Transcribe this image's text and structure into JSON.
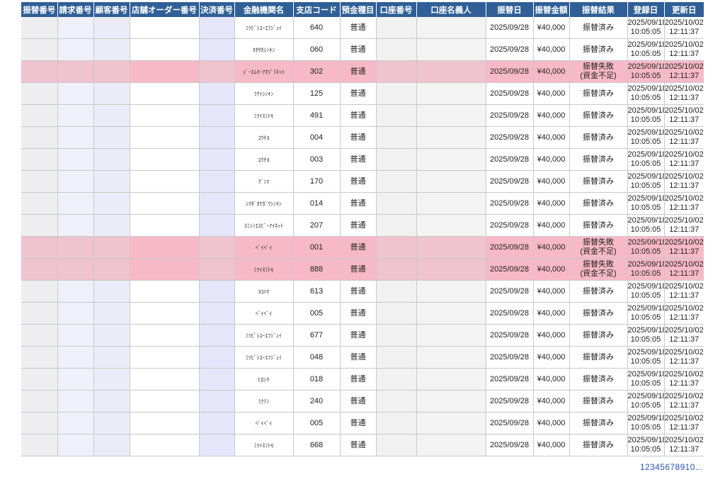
{
  "columns": [
    "振替番号",
    "請求番号",
    "顧客番号",
    "店舗オーダー番号",
    "決済番号",
    "金融機関名",
    "支店コード",
    "預金種目",
    "口座番号",
    "口座名義人",
    "振替日",
    "振替金額",
    "振替結果",
    "登録日",
    "更新日"
  ],
  "rows": [
    {
      "bank": "ﾐﾂﾋﾞｼﾕｰｴﾌｼﾞｪｲ",
      "branch": "640",
      "type": "普通",
      "date": "2025/09/28",
      "amount": "¥40,000",
      "result": "振替済み",
      "result2": "",
      "reg1": "2025/09/18",
      "reg2": "10:05:05",
      "upd1": "2025/10/02",
      "upd2": "12:11:37",
      "failed": false
    },
    {
      "bank": "ｵｵｻｶｼﾝｷﾝ",
      "branch": "060",
      "type": "普通",
      "date": "2025/09/28",
      "amount": "¥40,000",
      "result": "振替済み",
      "result2": "",
      "reg1": "2025/09/18",
      "reg2": "10:05:05",
      "upd1": "2025/10/02",
      "upd2": "12:11:37",
      "failed": false
    },
    {
      "bank": "ｼﾞｰｴﾑｵｰｱｵｿﾞﾗﾈｯﾄ",
      "branch": "302",
      "type": "普通",
      "date": "2025/09/28",
      "amount": "¥40,000",
      "result": "振替失敗",
      "result2": "(資金不足)",
      "reg1": "2025/09/18",
      "reg2": "10:05:05",
      "upd1": "2025/10/02",
      "upd2": "12:11:37",
      "failed": true
    },
    {
      "bank": "ﾌｸｲｼﾝｷﾝ",
      "branch": "125",
      "type": "普通",
      "date": "2025/09/28",
      "amount": "¥40,000",
      "result": "振替済み",
      "result2": "",
      "reg1": "2025/09/18",
      "reg2": "10:05:05",
      "upd1": "2025/10/02",
      "upd2": "12:11:37",
      "failed": false
    },
    {
      "bank": "ﾐﾂｲｽﾐﾄﾓ",
      "branch": "491",
      "type": "普通",
      "date": "2025/09/28",
      "amount": "¥40,000",
      "result": "振替済み",
      "result2": "",
      "reg1": "2025/09/18",
      "reg2": "10:05:05",
      "upd1": "2025/10/02",
      "upd2": "12:11:37",
      "failed": false
    },
    {
      "bank": "ﾕｳﾁﾖ",
      "branch": "004",
      "type": "普通",
      "date": "2025/09/28",
      "amount": "¥40,000",
      "result": "振替済み",
      "result2": "",
      "reg1": "2025/09/18",
      "reg2": "10:05:05",
      "upd1": "2025/10/02",
      "upd2": "12:11:37",
      "failed": false
    },
    {
      "bank": "ﾕｳﾁﾖ",
      "branch": "003",
      "type": "普通",
      "date": "2025/09/28",
      "amount": "¥40,000",
      "result": "振替済み",
      "result2": "",
      "reg1": "2025/09/18",
      "reg2": "10:05:05",
      "upd1": "2025/10/02",
      "upd2": "12:11:37",
      "failed": false
    },
    {
      "bank": "ｸﾞﾝﾏ",
      "branch": "170",
      "type": "普通",
      "date": "2025/09/28",
      "amount": "¥40,000",
      "result": "振替済み",
      "result2": "",
      "reg1": "2025/09/18",
      "reg2": "10:05:05",
      "upd1": "2025/10/02",
      "upd2": "12:11:37",
      "failed": false
    },
    {
      "bank": "ｼﾏﾀﾞｶｹｶﾞﾜｼﾝｷﾝ",
      "branch": "014",
      "type": "普通",
      "date": "2025/09/28",
      "amount": "¥40,000",
      "result": "振替済み",
      "result2": "",
      "reg1": "2025/09/18",
      "reg2": "10:05:05",
      "upd1": "2025/10/02",
      "upd2": "12:11:37",
      "failed": false
    },
    {
      "bank": "ｽﾐｼﾝｴｽﾋﾞｰｱｲﾈｯﾄ",
      "branch": "207",
      "type": "普通",
      "date": "2025/09/28",
      "amount": "¥40,000",
      "result": "振替済み",
      "result2": "",
      "reg1": "2025/09/18",
      "reg2": "10:05:05",
      "upd1": "2025/10/02",
      "upd2": "12:11:37",
      "failed": false
    },
    {
      "bank": "ﾍﾟｲﾍﾟｲ",
      "branch": "001",
      "type": "普通",
      "date": "2025/09/28",
      "amount": "¥40,000",
      "result": "振替失敗",
      "result2": "(資金不足)",
      "reg1": "2025/09/18",
      "reg2": "10:05:05",
      "upd1": "2025/10/02",
      "upd2": "12:11:37",
      "failed": true
    },
    {
      "bank": "ﾐﾂｲｽﾐﾄﾓ",
      "branch": "888",
      "type": "普通",
      "date": "2025/09/28",
      "amount": "¥40,000",
      "result": "振替失敗",
      "result2": "(資金不足)",
      "reg1": "2025/09/18",
      "reg2": "10:05:05",
      "upd1": "2025/10/02",
      "upd2": "12:11:37",
      "failed": true
    },
    {
      "bank": "ﾖｺﾊﾏ",
      "branch": "613",
      "type": "普通",
      "date": "2025/09/28",
      "amount": "¥40,000",
      "result": "振替済み",
      "result2": "",
      "reg1": "2025/09/18",
      "reg2": "10:05:05",
      "upd1": "2025/10/02",
      "upd2": "12:11:37",
      "failed": false
    },
    {
      "bank": "ﾍﾟｲﾍﾟｲ",
      "branch": "005",
      "type": "普通",
      "date": "2025/09/28",
      "amount": "¥40,000",
      "result": "振替済み",
      "result2": "",
      "reg1": "2025/09/18",
      "reg2": "10:05:05",
      "upd1": "2025/10/02",
      "upd2": "12:11:37",
      "failed": false
    },
    {
      "bank": "ﾐﾂﾋﾞｼﾕｰｴﾌｼﾞｪｲ",
      "branch": "677",
      "type": "普通",
      "date": "2025/09/28",
      "amount": "¥40,000",
      "result": "振替済み",
      "result2": "",
      "reg1": "2025/09/18",
      "reg2": "10:05:05",
      "upd1": "2025/10/02",
      "upd2": "12:11:37",
      "failed": false
    },
    {
      "bank": "ﾐﾂﾋﾞｼﾕｰｴﾌｼﾞｪｲ",
      "branch": "048",
      "type": "普通",
      "date": "2025/09/28",
      "amount": "¥40,000",
      "result": "振替済み",
      "result2": "",
      "reg1": "2025/09/18",
      "reg2": "10:05:05",
      "upd1": "2025/10/02",
      "upd2": "12:11:37",
      "failed": false
    },
    {
      "bank": "ﾋﾛｼﾏ",
      "branch": "018",
      "type": "普通",
      "date": "2025/09/28",
      "amount": "¥40,000",
      "result": "振替済み",
      "result2": "",
      "reg1": "2025/09/18",
      "reg2": "10:05:05",
      "upd1": "2025/10/02",
      "upd2": "12:11:37",
      "failed": false
    },
    {
      "bank": "ﾗｸﾃﾝ",
      "branch": "240",
      "type": "普通",
      "date": "2025/09/28",
      "amount": "¥40,000",
      "result": "振替済み",
      "result2": "",
      "reg1": "2025/09/18",
      "reg2": "10:05:05",
      "upd1": "2025/10/02",
      "upd2": "12:11:37",
      "failed": false
    },
    {
      "bank": "ﾍﾟｲﾍﾟｲ",
      "branch": "005",
      "type": "普通",
      "date": "2025/09/28",
      "amount": "¥40,000",
      "result": "振替済み",
      "result2": "",
      "reg1": "2025/09/18",
      "reg2": "10:05:05",
      "upd1": "2025/10/02",
      "upd2": "12:11:37",
      "failed": false
    },
    {
      "bank": "ﾐﾂｲｽﾐﾄﾓ",
      "branch": "668",
      "type": "普通",
      "date": "2025/09/28",
      "amount": "¥40,000",
      "result": "振替済み",
      "result2": "",
      "reg1": "2025/09/18",
      "reg2": "10:05:05",
      "upd1": "2025/10/02",
      "upd2": "12:11:37",
      "failed": false
    }
  ],
  "pagination": {
    "pages": [
      "1",
      "2",
      "3",
      "4",
      "5",
      "6",
      "7",
      "8",
      "9",
      "10"
    ],
    "more": "..."
  },
  "colors": {
    "header_bg": "#2f5f96",
    "header_text": "#ffffff",
    "failed_row_bg": "#f7b9c7",
    "link": "#2a55b5"
  }
}
